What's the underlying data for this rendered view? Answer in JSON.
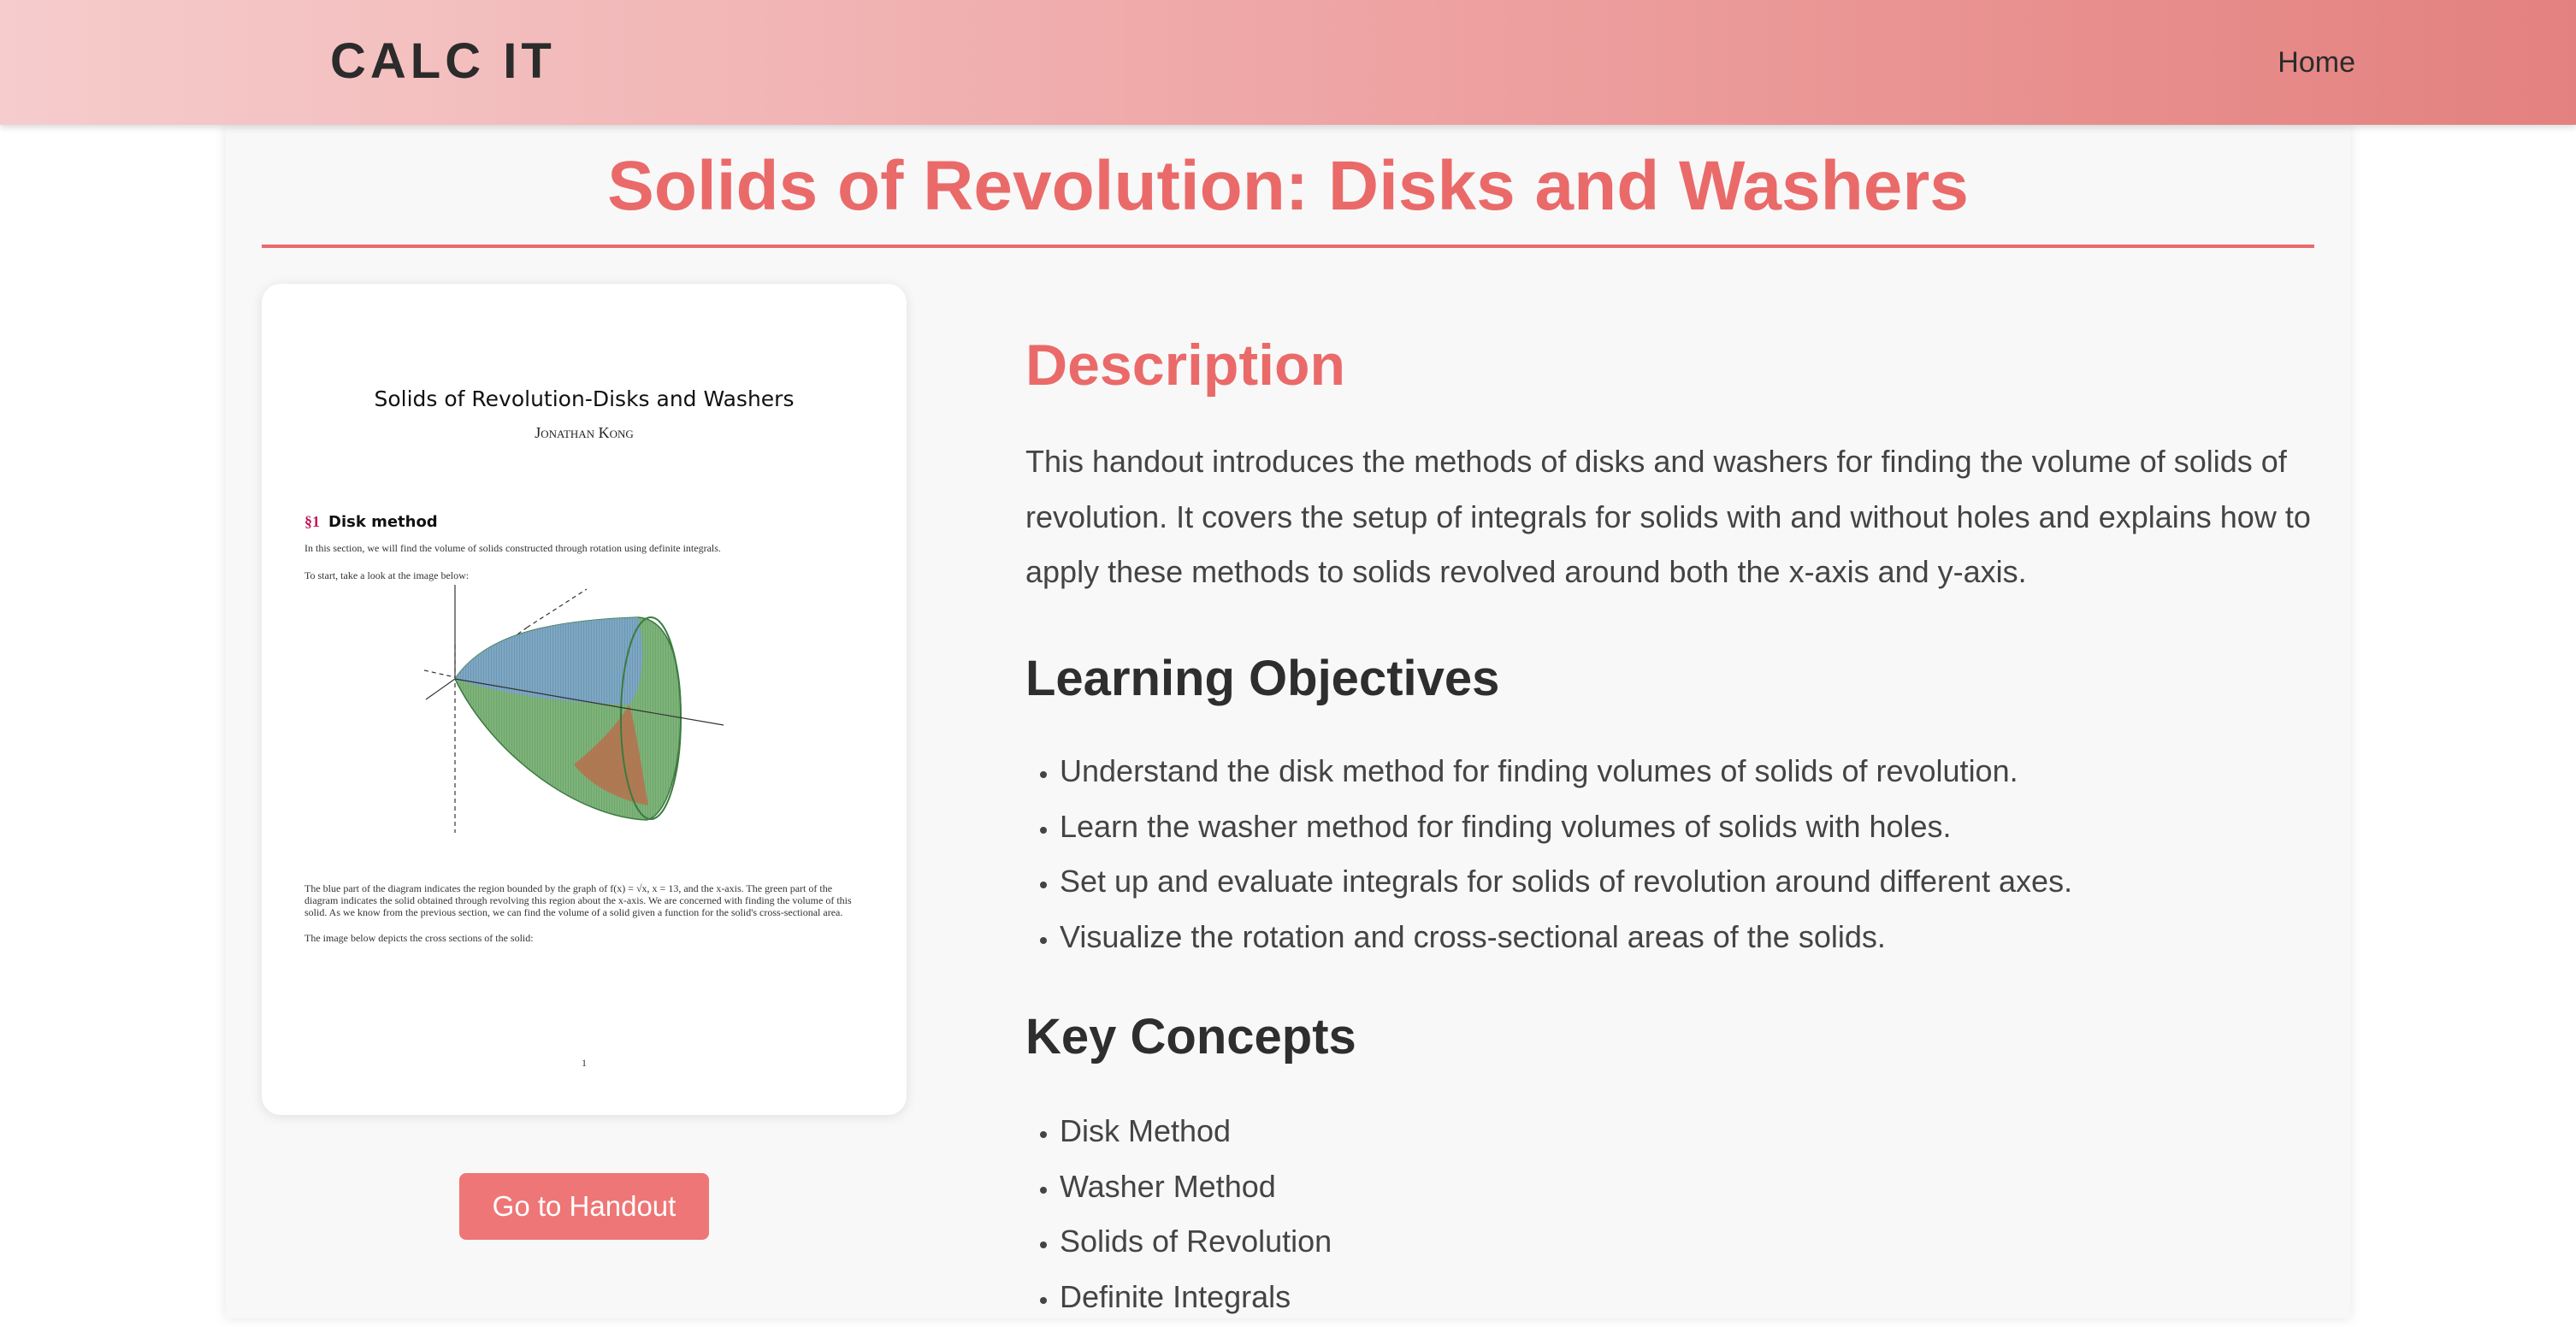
{
  "navbar": {
    "brand": "CALC IT",
    "home_link": "Home"
  },
  "page": {
    "title": "Solids of Revolution: Disks and Washers"
  },
  "preview": {
    "doc_title": "Solids of Revolution-Disks and Washers",
    "doc_author": "Jonathan Kong",
    "section_number": "§1",
    "section_title": "Disk method",
    "para1": "In this section, we will find the volume of solids constructed through rotation using definite integrals.",
    "para2": "To start, take a look at the image below:",
    "para3": "The blue part of the diagram indicates the region bounded by the graph of f(x) = √x, x = 13, and the x-axis. The green part of the diagram indicates the solid obtained through revolving this region about the x-axis. We are concerned with finding the volume of this solid. As we know from the previous section, we can find the volume of a solid given a function for the solid's cross-sectional area.",
    "para4": "The image below depicts the cross sections of the solid:",
    "page_number": "1"
  },
  "handout_button": "Go to Handout",
  "description": {
    "heading": "Description",
    "text": "This handout introduces the methods of disks and washers for finding the volume of solids of revolution. It covers the setup of integrals for solids with and without holes and explains how to apply these methods to solids revolved around both the x-axis and y-axis."
  },
  "objectives": {
    "heading": "Learning Objectives",
    "items": [
      "Understand the disk method for finding volumes of solids of revolution.",
      "Learn the washer method for finding volumes of solids with holes.",
      "Set up and evaluate integrals for solids of revolution around different axes.",
      "Visualize the rotation and cross-sectional areas of the solids."
    ]
  },
  "concepts": {
    "heading": "Key Concepts",
    "items": [
      "Disk Method",
      "Washer Method",
      "Solids of Revolution",
      "Definite Integrals"
    ]
  },
  "colors": {
    "accent": "#ea6a6a",
    "button": "#ef7676",
    "nav_gradient_start": "#f6cccc",
    "nav_gradient_end": "#e3817f"
  }
}
